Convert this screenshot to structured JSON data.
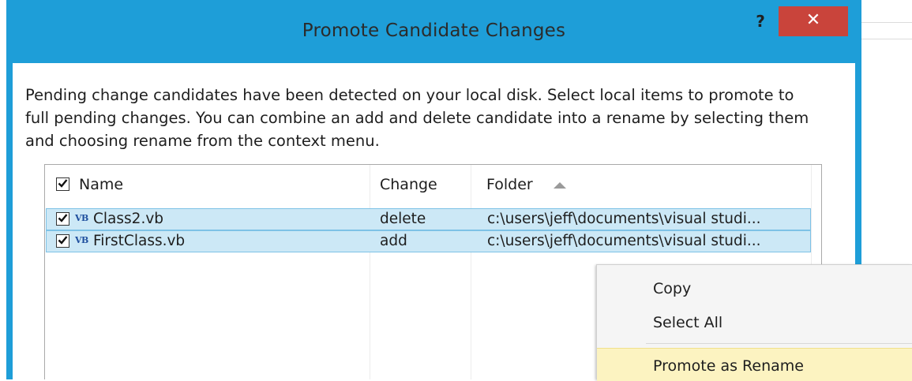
{
  "dialog": {
    "title": "Promote Candidate Changes",
    "help_label": "?",
    "close_label": "✕",
    "description": "Pending change candidates have been detected on your local disk. Select local items to promote to full pending changes. You can combine an add and delete candidate into a rename by selecting them and choosing rename from the context menu."
  },
  "list": {
    "columns": {
      "name": "Name",
      "change": "Change",
      "folder": "Folder"
    },
    "sort_column": "Folder",
    "sort_direction": "ascending",
    "select_all_checked": true,
    "rows": [
      {
        "checked": true,
        "icon": "VB",
        "name": "Class2.vb",
        "change": "delete",
        "folder": "c:\\users\\jeff\\documents\\visual studi..."
      },
      {
        "checked": true,
        "icon": "VB",
        "name": "FirstClass.vb",
        "change": "add",
        "folder": "c:\\users\\jeff\\documents\\visual studi..."
      }
    ]
  },
  "context_menu": {
    "items": [
      {
        "label": "Copy"
      },
      {
        "label": "Select All"
      },
      {
        "label": "Promote as Rename",
        "highlighted": true
      }
    ]
  },
  "colors": {
    "frame": "#1e9ed8",
    "close_button": "#c9443b",
    "row_selected": "#cce8f6",
    "menu_highlight": "#fcf3c1"
  }
}
